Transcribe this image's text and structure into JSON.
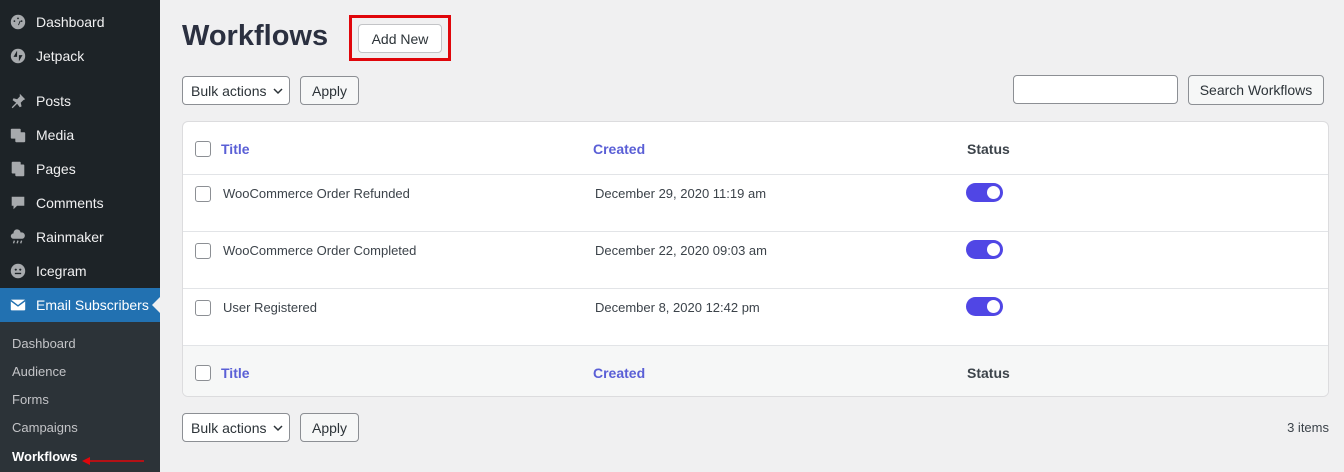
{
  "sidebar": {
    "items": [
      {
        "label": "Dashboard",
        "icon": "dashboard-icon"
      },
      {
        "label": "Jetpack",
        "icon": "jetpack-icon"
      },
      {
        "label": "Posts",
        "icon": "pin-icon"
      },
      {
        "label": "Media",
        "icon": "media-icon"
      },
      {
        "label": "Pages",
        "icon": "pages-icon"
      },
      {
        "label": "Comments",
        "icon": "comments-icon"
      },
      {
        "label": "Rainmaker",
        "icon": "cloud-icon"
      },
      {
        "label": "Icegram",
        "icon": "icegram-icon"
      },
      {
        "label": "Email Subscribers",
        "icon": "email-icon"
      }
    ],
    "submenu": [
      "Dashboard",
      "Audience",
      "Forms",
      "Campaigns",
      "Workflows"
    ],
    "current_submenu": "Workflows"
  },
  "header": {
    "title": "Workflows",
    "add_new_label": "Add New"
  },
  "toolbar": {
    "bulk_actions_label": "Bulk actions",
    "apply_label": "Apply",
    "search_placeholder": "",
    "search_button_label": "Search Workflows"
  },
  "table": {
    "columns": [
      "Title",
      "Created",
      "Status"
    ],
    "rows": [
      {
        "title": "WooCommerce Order Refunded",
        "created": "December 29, 2020 11:19 am",
        "status_on": true
      },
      {
        "title": "WooCommerce Order Completed",
        "created": "December 22, 2020 09:03 am",
        "status_on": true
      },
      {
        "title": "User Registered",
        "created": "December 8, 2020 12:42 pm",
        "status_on": true
      }
    ]
  },
  "footer": {
    "bulk_actions_label": "Bulk actions",
    "apply_label": "Apply",
    "items_count": "3 items"
  },
  "colors": {
    "sidebar_bg": "#1d2327",
    "active_menu": "#2271b1",
    "toggle_on": "#5046e5",
    "link": "#5a5fd6",
    "highlight": "#e0060b"
  }
}
